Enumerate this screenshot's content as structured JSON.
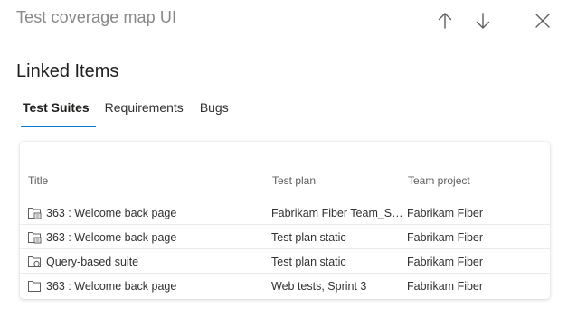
{
  "panel": {
    "title": "Test coverage map UI",
    "icons": {
      "up": "arrow-up-icon",
      "down": "arrow-down-icon",
      "close": "close-icon"
    }
  },
  "section": {
    "heading": "Linked Items",
    "tabs": [
      {
        "label": "Test Suites",
        "active": true
      },
      {
        "label": "Requirements",
        "active": false
      },
      {
        "label": "Bugs",
        "active": false
      }
    ]
  },
  "table": {
    "columns": {
      "title": "Title",
      "plan": "Test plan",
      "project": "Team project"
    },
    "rows": [
      {
        "icon": "requirement-suite-icon",
        "title": "363 : Welcome back page",
        "plan": "Fabrikam Fiber Team_St...",
        "project": "Fabrikam Fiber"
      },
      {
        "icon": "requirement-suite-icon",
        "title": "363 : Welcome back page",
        "plan": "Test plan static",
        "project": "Fabrikam Fiber"
      },
      {
        "icon": "query-suite-icon",
        "title": "Query-based suite",
        "plan": "Test plan static",
        "project": "Fabrikam Fiber"
      },
      {
        "icon": "static-suite-icon",
        "title": "363 : Welcome back page",
        "plan": "Web tests, Sprint 3",
        "project": "Fabrikam Fiber"
      }
    ]
  },
  "colors": {
    "accent": "#0078d4",
    "border": "#edebe9",
    "muted": "#8a8886"
  }
}
